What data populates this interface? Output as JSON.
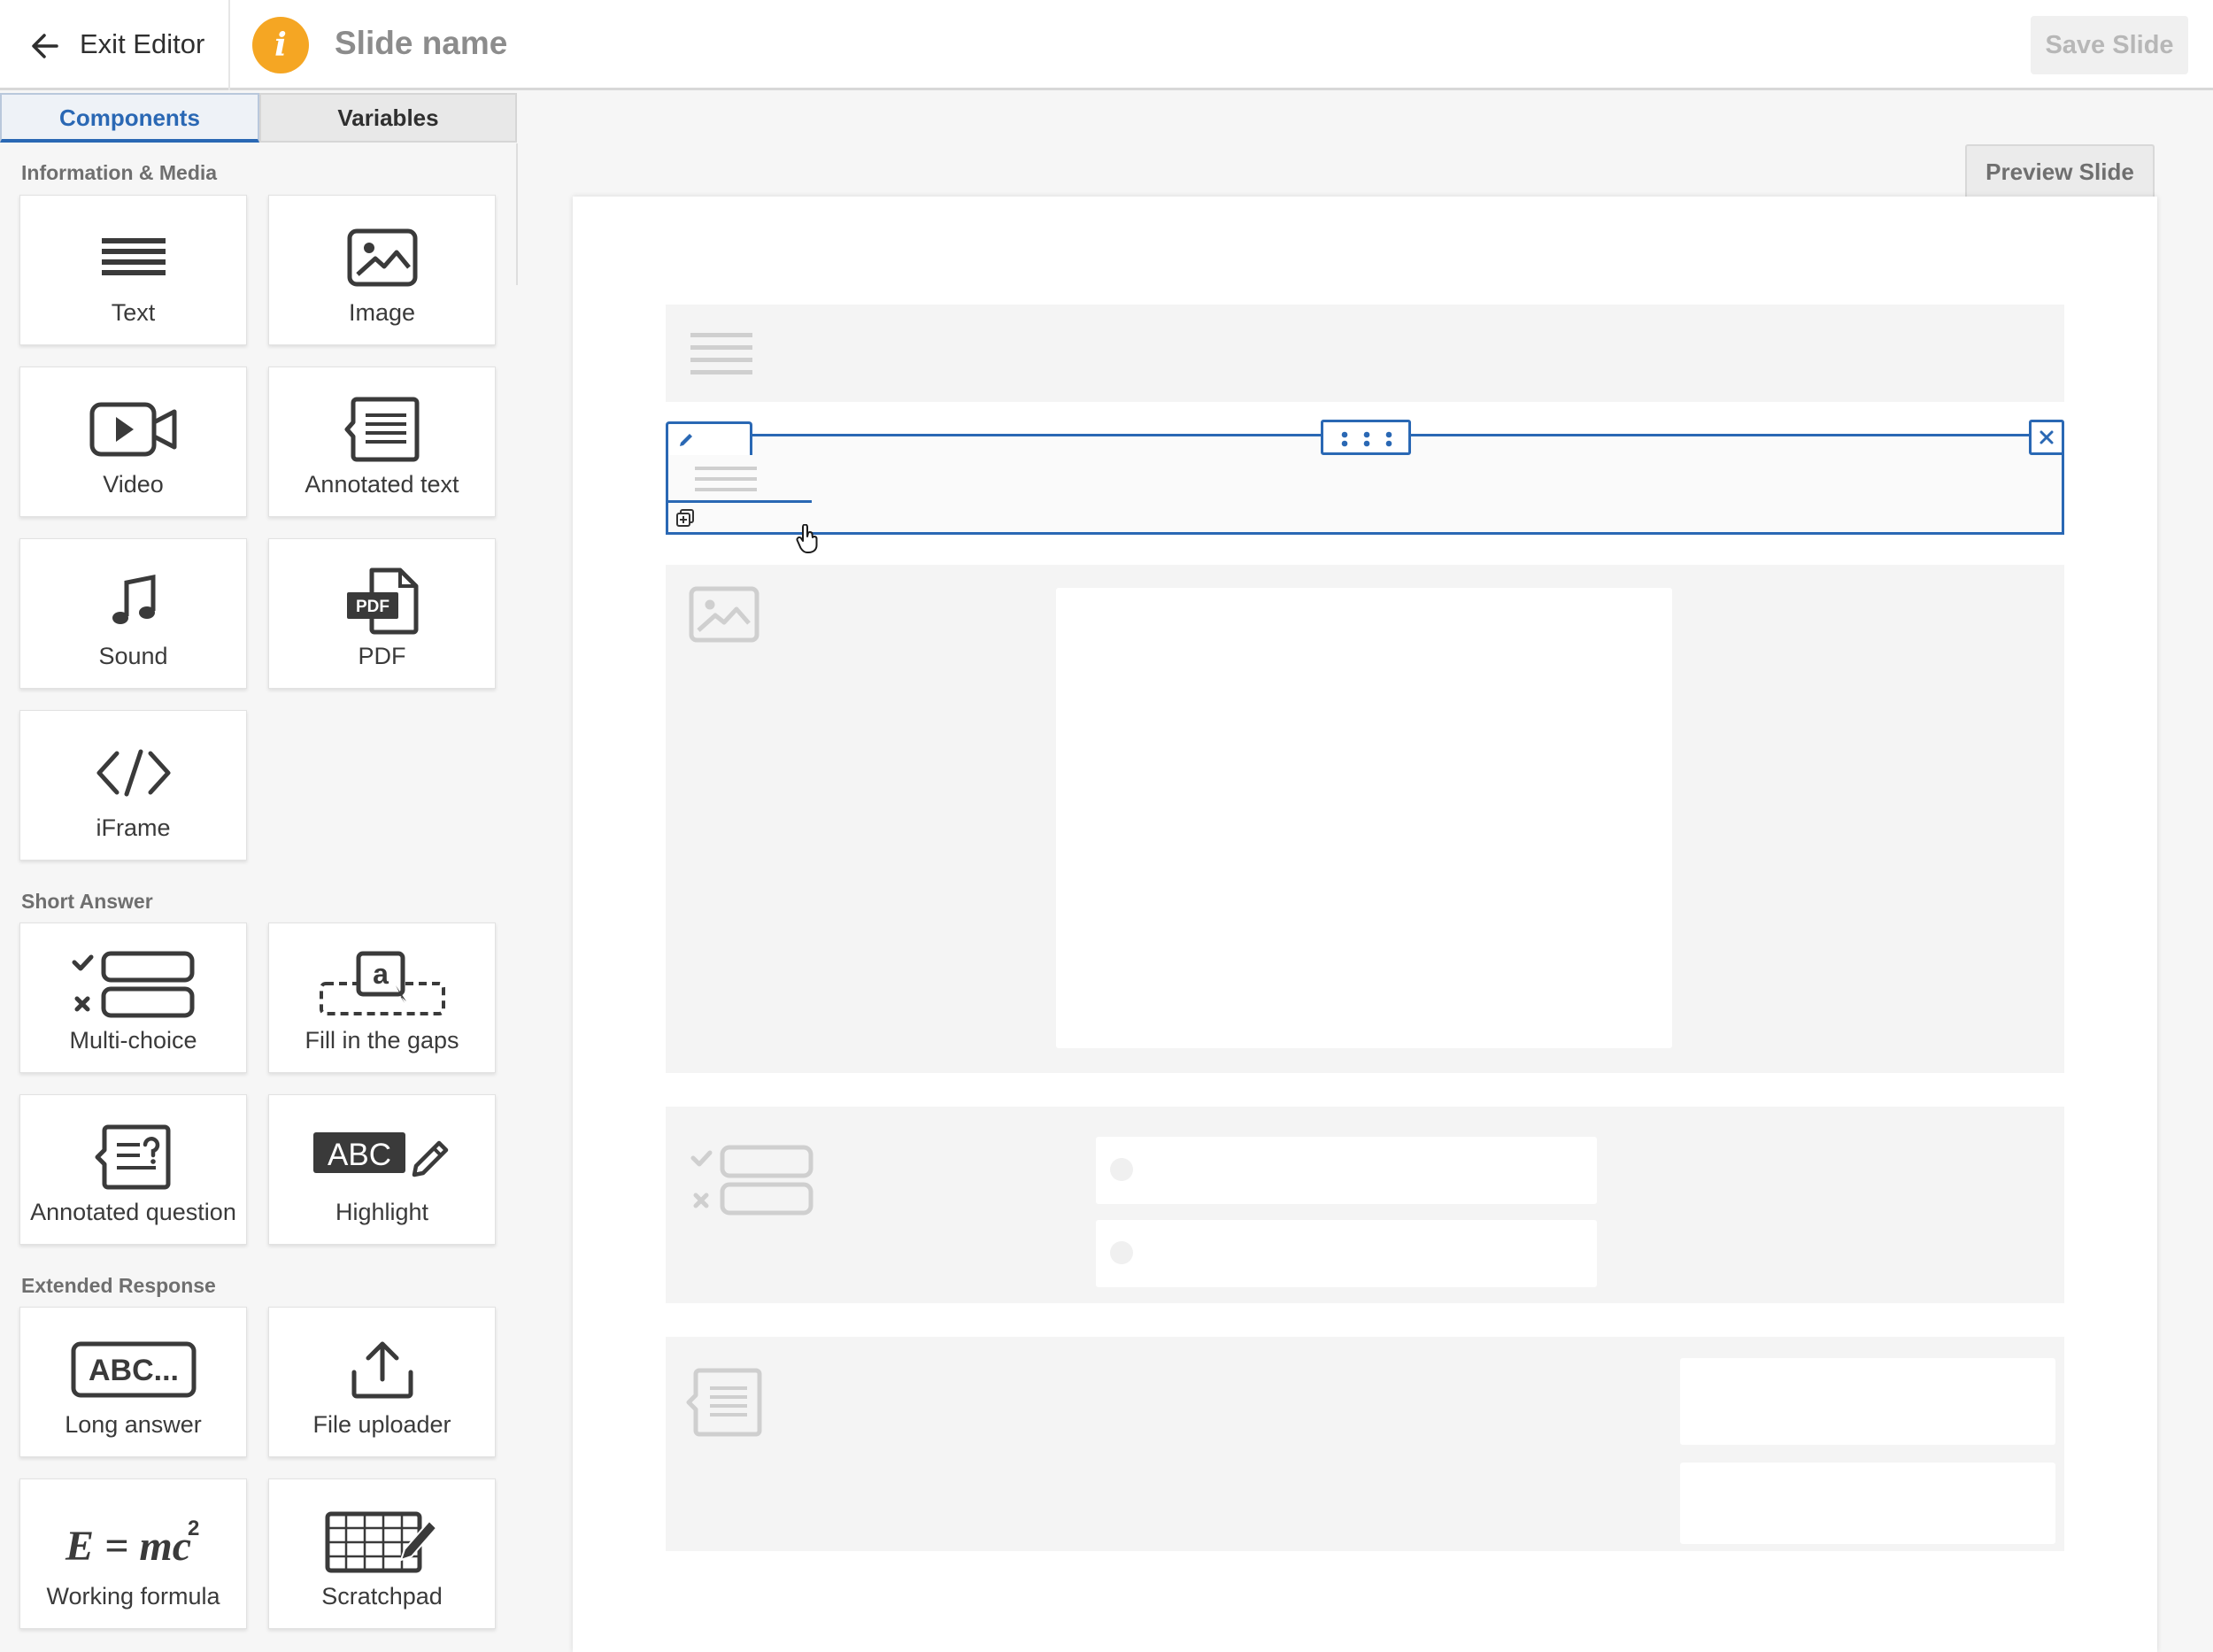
{
  "topbar": {
    "exit_label": "Exit Editor",
    "info_glyph": "i",
    "slide_name": "Slide name",
    "save_label": "Save Slide"
  },
  "sidebar": {
    "tabs": [
      {
        "label": "Components",
        "active": true
      },
      {
        "label": "Variables",
        "active": false
      }
    ],
    "sections": [
      {
        "title": "Information & Media",
        "items": [
          {
            "label": "Text",
            "icon": "text-lines-icon"
          },
          {
            "label": "Image",
            "icon": "image-icon"
          },
          {
            "label": "Video",
            "icon": "video-camera-icon"
          },
          {
            "label": "Annotated text",
            "icon": "annotated-text-icon"
          },
          {
            "label": "Sound",
            "icon": "music-note-icon"
          },
          {
            "label": "PDF",
            "icon": "pdf-file-icon"
          },
          {
            "label": "iFrame",
            "icon": "code-brackets-icon"
          }
        ]
      },
      {
        "title": "Short Answer",
        "items": [
          {
            "label": "Multi-choice",
            "icon": "multi-choice-icon"
          },
          {
            "label": "Fill in the gaps",
            "icon": "fill-gaps-icon"
          },
          {
            "label": "Annotated question",
            "icon": "annotated-question-icon"
          },
          {
            "label": "Highlight",
            "icon": "highlight-abc-icon"
          }
        ]
      },
      {
        "title": "Extended Response",
        "items": [
          {
            "label": "Long answer",
            "icon": "long-answer-icon"
          },
          {
            "label": "File uploader",
            "icon": "upload-icon"
          },
          {
            "label": "Working formula",
            "icon": "formula-icon"
          },
          {
            "label": "Scratchpad",
            "icon": "scratchpad-grid-icon"
          }
        ]
      }
    ],
    "icon_text": {
      "pdf": "PDF",
      "fill_gap_letter": "a",
      "highlight": "ABC",
      "long_answer": "ABC...",
      "formula": "E = mc",
      "formula_sup": "2"
    }
  },
  "canvas": {
    "preview_label": "Preview Slide",
    "blocks": [
      "text-block",
      "selected-text-block",
      "image-block",
      "multi-choice-block",
      "annotated-text-block"
    ]
  },
  "colors": {
    "accent": "#2a68b4",
    "info_badge": "#f5a623",
    "placeholder_grey": "#c9c9c9"
  }
}
